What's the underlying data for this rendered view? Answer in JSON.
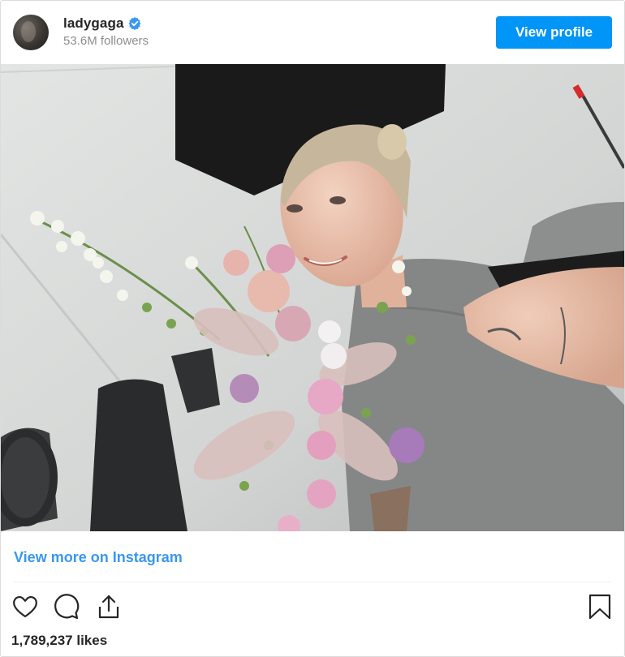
{
  "header": {
    "username": "ladygaga",
    "followers": "53.6M followers",
    "view_profile_label": "View profile"
  },
  "post": {
    "view_more_label": "View more on Instagram",
    "likes": "1,789,237 likes"
  },
  "icons": {
    "verified": "verified-badge-icon",
    "like": "heart-icon",
    "comment": "comment-icon",
    "share": "share-icon",
    "save": "bookmark-icon"
  },
  "colors": {
    "accent": "#0095f6",
    "link": "#3897f0",
    "verified": "#3897f0",
    "text": "#262626",
    "muted": "#8e8e8e"
  }
}
